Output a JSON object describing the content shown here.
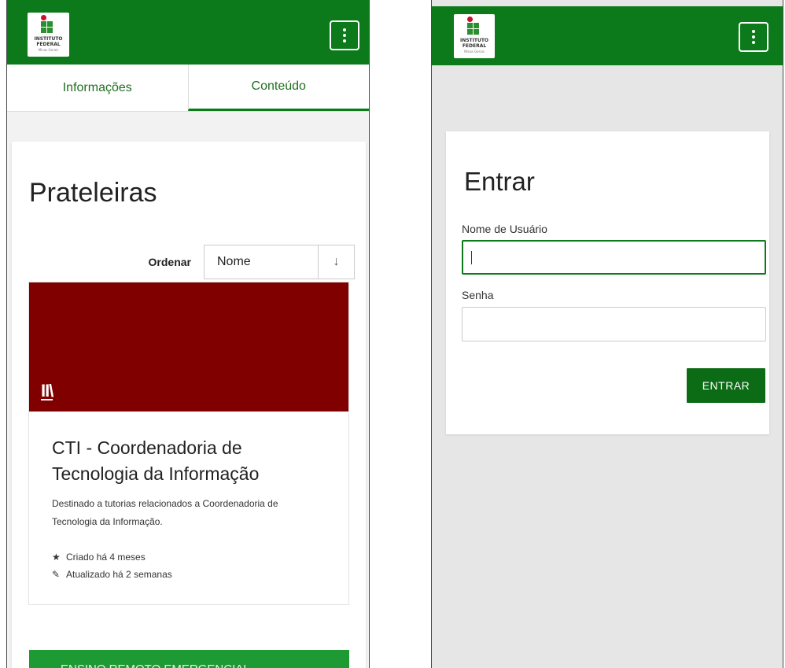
{
  "brand": {
    "logo_line1": "INSTITUTO",
    "logo_line2": "FEDERAL",
    "logo_line3": "Minas Gerais",
    "header_color": "#0c7a1b"
  },
  "left_screen": {
    "tabs": [
      {
        "label": "Informações",
        "active": false
      },
      {
        "label": "Conteúdo",
        "active": true
      }
    ],
    "page_title": "Prateleiras",
    "sort": {
      "label": "Ordenar",
      "selected": "Nome",
      "direction_icon": "↓"
    },
    "shelf": {
      "cover_color": "#800000",
      "icon": "bookshelf-icon",
      "title": "CTI - Coordenadoria de Tecnologia da Informação",
      "description": "Destinado a tutorias relacionados a Coordenadoria de Tecnologia da Informação.",
      "created": "Criado há 4 meses",
      "updated": "Atualizado há 2 semanas"
    },
    "next_shelf_title": "ENSINO REMOTO EMERGENCIAL"
  },
  "right_screen": {
    "login_title": "Entrar",
    "username_label": "Nome de Usuário",
    "username_value": "",
    "password_label": "Senha",
    "password_value": "",
    "submit_label": "ENTRAR"
  }
}
